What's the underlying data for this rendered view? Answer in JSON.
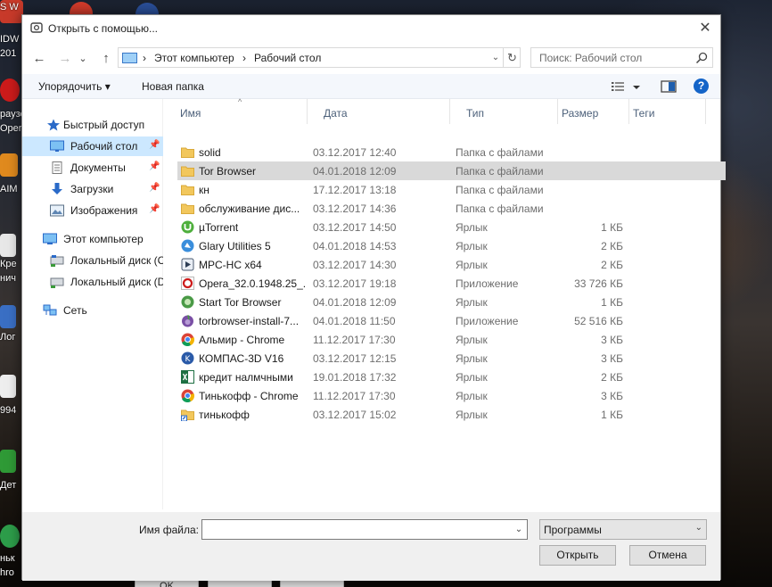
{
  "window": {
    "title": "Открыть с помощью...",
    "close_glyph": "✕"
  },
  "nav": {
    "back_glyph": "←",
    "forward_glyph": "→",
    "recent_glyph": "⌄",
    "up_glyph": "↑"
  },
  "address": {
    "crumbs": [
      "Этот компьютер",
      "Рабочий стол"
    ],
    "separator": "›",
    "drop_glyph": "⌄",
    "refresh_glyph": "↻"
  },
  "search": {
    "placeholder": "Поиск: Рабочий стол"
  },
  "toolbar": {
    "organize_label": "Упорядочить ▾",
    "new_folder_label": "Новая папка",
    "help_glyph": "?"
  },
  "sidebar": {
    "items": [
      {
        "label": "Быстрый доступ",
        "icon": "star-icon",
        "pinned": false
      },
      {
        "label": "Рабочий стол",
        "icon": "desktop-icon",
        "pinned": true
      },
      {
        "label": "Документы",
        "icon": "documents-icon",
        "pinned": true
      },
      {
        "label": "Загрузки",
        "icon": "download-icon",
        "pinned": true
      },
      {
        "label": "Изображения",
        "icon": "pictures-icon",
        "pinned": true
      },
      {
        "label": "Этот компьютер",
        "icon": "computer-icon",
        "pinned": false
      },
      {
        "label": "Локальный диск (C",
        "icon": "drive-icon",
        "pinned": false
      },
      {
        "label": "Локальный диск (D",
        "icon": "drive-icon",
        "pinned": false
      },
      {
        "label": "Сеть",
        "icon": "network-icon",
        "pinned": false
      }
    ]
  },
  "columns": {
    "name": "Имя",
    "date": "Дата",
    "type": "Тип",
    "size": "Размер",
    "tags": "Теги",
    "sort_glyph": "^"
  },
  "files": [
    {
      "name": "solid",
      "date": "03.12.2017 12:40",
      "type": "Папка с файлами",
      "size": "",
      "icon": "folder-icon"
    },
    {
      "name": "Tor Browser",
      "date": "04.01.2018 12:09",
      "type": "Папка с файлами",
      "size": "",
      "icon": "folder-icon"
    },
    {
      "name": "кн",
      "date": "17.12.2017 13:18",
      "type": "Папка с файлами",
      "size": "",
      "icon": "folder-icon"
    },
    {
      "name": "обслуживание дис...",
      "date": "03.12.2017 14:36",
      "type": "Папка с файлами",
      "size": "",
      "icon": "folder-icon"
    },
    {
      "name": "µTorrent",
      "date": "03.12.2017 14:50",
      "type": "Ярлык",
      "size": "1 КБ",
      "icon": "utorrent-icon"
    },
    {
      "name": "Glary Utilities 5",
      "date": "04.01.2018 14:53",
      "type": "Ярлык",
      "size": "2 КБ",
      "icon": "glary-icon"
    },
    {
      "name": "MPC-HC x64",
      "date": "03.12.2017 14:30",
      "type": "Ярлык",
      "size": "2 КБ",
      "icon": "mpc-icon"
    },
    {
      "name": "Opera_32.0.1948.25_...",
      "date": "03.12.2017 19:18",
      "type": "Приложение",
      "size": "33 726 КБ",
      "icon": "opera-icon"
    },
    {
      "name": "Start Tor Browser",
      "date": "04.01.2018 12:09",
      "type": "Ярлык",
      "size": "1 КБ",
      "icon": "tor-icon"
    },
    {
      "name": "torbrowser-install-7...",
      "date": "04.01.2018 11:50",
      "type": "Приложение",
      "size": "52 516 КБ",
      "icon": "tor-installer-icon"
    },
    {
      "name": "Альмир - Chrome",
      "date": "11.12.2017 17:30",
      "type": "Ярлык",
      "size": "3 КБ",
      "icon": "chrome-icon"
    },
    {
      "name": "КОМПАС-3D V16",
      "date": "03.12.2017 12:15",
      "type": "Ярлык",
      "size": "3 КБ",
      "icon": "kompas-icon"
    },
    {
      "name": "кредит налмчными",
      "date": "19.01.2018 17:32",
      "type": "Ярлык",
      "size": "2 КБ",
      "icon": "excel-icon"
    },
    {
      "name": "Тинькофф - Chrome",
      "date": "11.12.2017 17:30",
      "type": "Ярлык",
      "size": "3 КБ",
      "icon": "chrome-icon"
    },
    {
      "name": "тинькофф",
      "date": "03.12.2017 15:02",
      "type": "Ярлык",
      "size": "1 КБ",
      "icon": "folder-shortcut-icon"
    }
  ],
  "bottom": {
    "filename_label": "Имя файла:",
    "filename_value": "",
    "filter_value": "Программы",
    "open_label": "Открыть",
    "cancel_label": "Отмена"
  },
  "desktop_bg": {
    "labels": [
      "S W",
      "IDW",
      "201",
      "раузе",
      "Oper",
      "AIM",
      "Кре",
      "нич",
      "Лог",
      "994",
      "Дет",
      "ньк",
      "hro"
    ],
    "buttons": [
      "OK",
      "",
      ""
    ]
  },
  "colors": {
    "selection": "#cce8ff",
    "row_highlight": "#d9d9d9",
    "folder": "#f2c75c",
    "accent": "#1464c8"
  }
}
